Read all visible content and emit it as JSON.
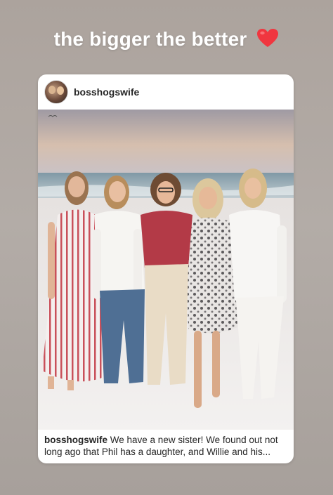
{
  "story": {
    "caption": "the bigger the better",
    "heart_icon": "red-heart-emoji",
    "heart_color": "#f0363f"
  },
  "post": {
    "username": "bosshogswife",
    "caption_username": "bosshogswife",
    "caption_text": " We have a new sister! We found out not long ago that Phil has a daughter, and Willie and his...",
    "photo_alt": "Five women standing together on a sandy beach at sunset"
  }
}
